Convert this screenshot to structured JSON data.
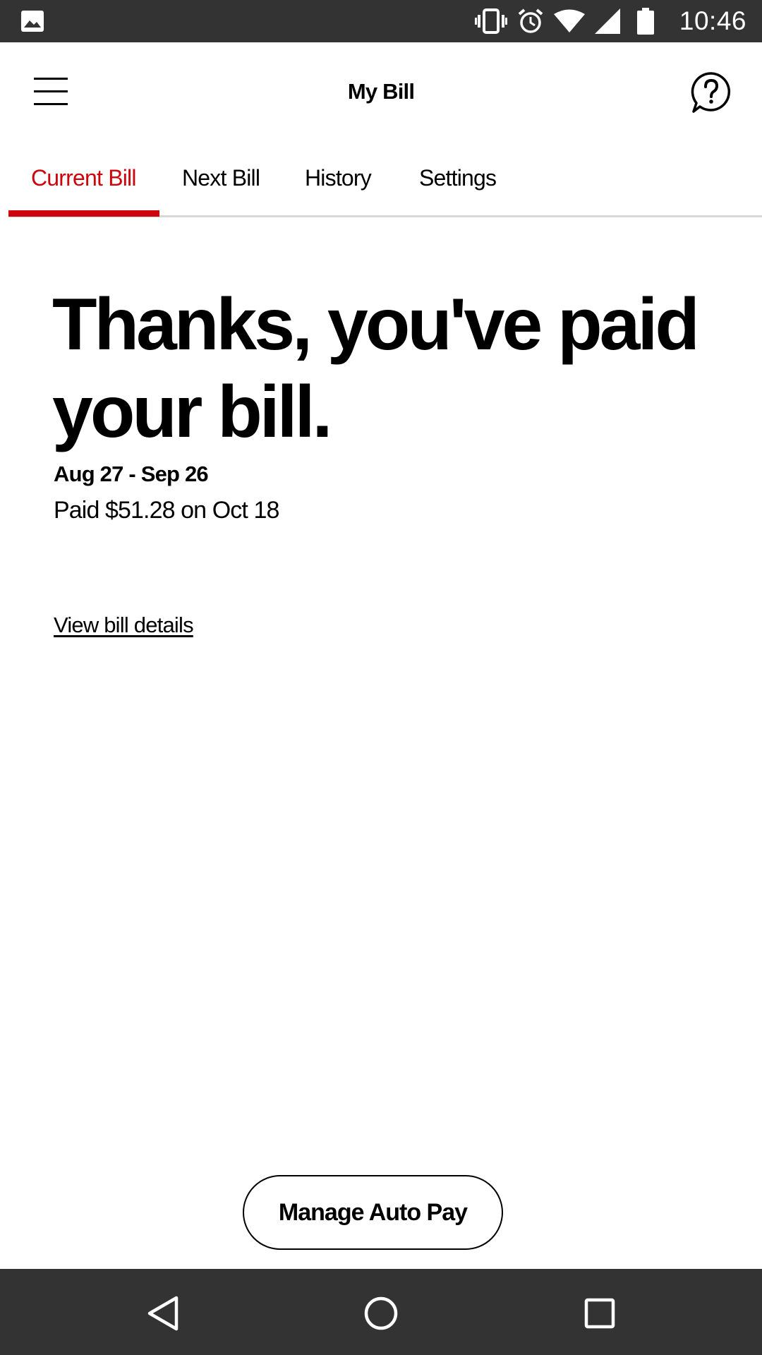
{
  "status_bar": {
    "time": "10:46",
    "icons": [
      "gallery-icon",
      "vibrate-icon",
      "alarm-icon",
      "wifi-icon",
      "signal-icon",
      "battery-icon"
    ]
  },
  "header": {
    "title": "My Bill",
    "menu_icon": "hamburger-menu-icon",
    "help_icon": "help-chat-icon"
  },
  "tabs": [
    {
      "label": "Current Bill",
      "active": true
    },
    {
      "label": "Next Bill",
      "active": false
    },
    {
      "label": "History",
      "active": false
    },
    {
      "label": "Settings",
      "active": false
    }
  ],
  "main": {
    "headline": "Thanks, you've paid your bill.",
    "period": "Aug 27 - Sep 26",
    "paid_text": "Paid $51.28 on Oct 18",
    "details_link": "View bill details"
  },
  "actions": {
    "autopay_label": "Manage Auto Pay"
  },
  "nav_bar": {
    "icons": [
      "back-icon",
      "home-icon",
      "recents-icon"
    ]
  },
  "colors": {
    "accent": "#cd040b",
    "system_bar": "#333333"
  }
}
